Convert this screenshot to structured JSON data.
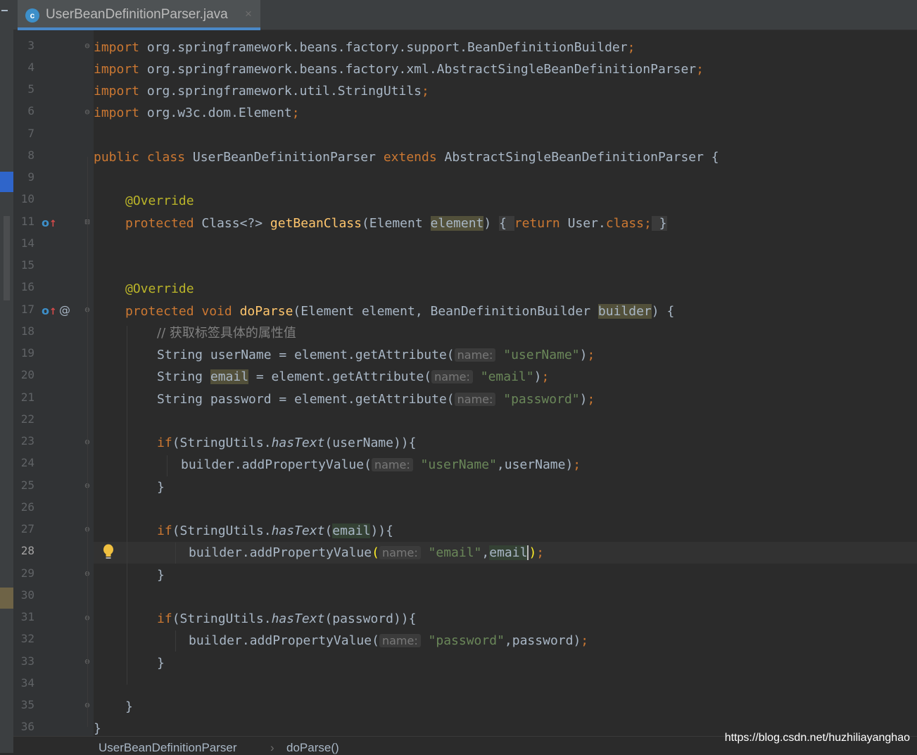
{
  "tab": {
    "icon_letter": "c",
    "title": "UserBeanDefinitionParser.java",
    "close_glyph": "×"
  },
  "line_numbers": [
    "3",
    "4",
    "5",
    "6",
    "7",
    "8",
    "9",
    "10",
    "11",
    "14",
    "15",
    "16",
    "17",
    "18",
    "19",
    "20",
    "21",
    "22",
    "23",
    "24",
    "25",
    "26",
    "27",
    "28",
    "29",
    "30",
    "31",
    "32",
    "33",
    "34",
    "35",
    "36"
  ],
  "current_line": "28",
  "code": {
    "l3": {
      "k": "import",
      "t": " org.springframework.beans.factory.support.BeanDefinitionBuilder",
      "p": ";"
    },
    "l4": {
      "k": "import",
      "t": " org.springframework.beans.factory.xml.AbstractSingleBeanDefinitionParser",
      "p": ";"
    },
    "l5": {
      "k": "import",
      "t": " org.springframework.util.StringUtils",
      "p": ";"
    },
    "l6": {
      "k": "import",
      "t": " org.w3c.dom.Element",
      "p": ";"
    },
    "l8": {
      "k1": "public class",
      "t1": " UserBeanDefinitionParser ",
      "k2": "extends",
      "t2": " AbstractSingleBeanDefinitionParser {"
    },
    "l10": {
      "a": "@Override"
    },
    "l11": {
      "k": "protected",
      "t1": " Class<?> ",
      "m": "getBeanClass",
      "t2": "(Element ",
      "hl": "element",
      "t3": ") ",
      "fb1": "{ ",
      "k2": "return",
      "t4": " User.",
      "k3": "class;",
      "fb2": " }"
    },
    "l16": {
      "a": "@Override"
    },
    "l17": {
      "k": "protected void",
      "sp": " ",
      "m": "doParse",
      "t1": "(Element element, BeanDefinitionBuilder ",
      "hl": "builder",
      "t2": ") {"
    },
    "l18": {
      "c": "// 获取标签具体的属性值"
    },
    "l19": {
      "t1": "String userName = element.getAttribute(",
      "h": "name:",
      "s": " \"userName\"",
      "t2": ")",
      "p": ";"
    },
    "l20": {
      "t1": "String ",
      "hl": "email",
      "t2": " = element.getAttribute(",
      "h": "name:",
      "s": " \"email\"",
      "t3": ")",
      "p": ";"
    },
    "l21": {
      "t1": "String password = element.getAttribute(",
      "h": "name:",
      "s": " \"password\"",
      "t2": ")",
      "p": ";"
    },
    "l23": {
      "k": "if",
      "t1": "(StringUtils.",
      "st": "hasText",
      "t2": "(userName)){"
    },
    "l24": {
      "t1": "builder.addPropertyValue(",
      "h": "name:",
      "s": " \"userName\"",
      "t2": ",userName)",
      "p": ";"
    },
    "l25": {
      "t": "}"
    },
    "l27": {
      "k": "if",
      "t1": "(StringUtils.",
      "st": "hasText",
      "t2": "(",
      "hl": "email",
      "t3": ")){"
    },
    "l28": {
      "t1": "builder.addPropertyValue",
      "b1": "(",
      "h": "name:",
      "s": " \"email\"",
      "t2": ",",
      "hl": "email",
      "b2": ")",
      "p": ";"
    },
    "l29": {
      "t": "}"
    },
    "l31": {
      "k": "if",
      "t1": "(StringUtils.",
      "st": "hasText",
      "t2": "(password)){"
    },
    "l32": {
      "t1": "builder.addPropertyValue(",
      "h": "name:",
      "s": " \"password\"",
      "t2": ",password)",
      "p": ";"
    },
    "l33": {
      "t": "}"
    },
    "l35": {
      "t": "}"
    },
    "l36": {
      "t": "}"
    }
  },
  "breadcrumbs": [
    "UserBeanDefinitionParser",
    "›",
    "doParse()"
  ],
  "watermark": "https://blog.csdn.net/huzhiliayanghao",
  "colors": {
    "keyword": "#cc7832",
    "annotation": "#bbb529",
    "string": "#6a8759",
    "method": "#ffc66d",
    "text": "#a9b7c6",
    "comment": "#808080",
    "tab_accent": "#4a88c7"
  }
}
